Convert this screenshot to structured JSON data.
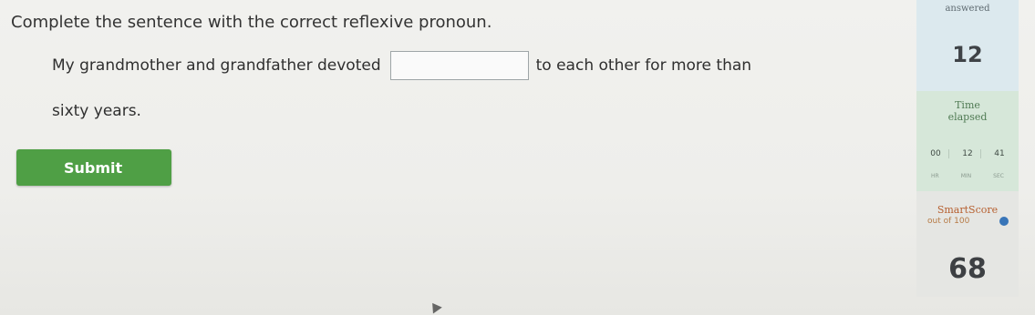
{
  "question": {
    "instructions": "Complete the sentence with the correct reflexive pronoun.",
    "sentence_before": "My grandmother and grandfather devoted",
    "sentence_after": "to each other for more than",
    "sentence_line2": "sixty years.",
    "answer_value": "",
    "submit_label": "Submit"
  },
  "sidebar": {
    "answered_label": "answered",
    "questions_answered": "12",
    "time_label_line1": "Time",
    "time_label_line2": "elapsed",
    "time": {
      "hours": "00",
      "minutes": "12",
      "seconds": "41",
      "hours_unit": "HR",
      "minutes_unit": "MIN",
      "seconds_unit": "SEC"
    },
    "smartscore_label": "SmartScore",
    "smartscore_sub": "out of 100",
    "smartscore_value": "68"
  },
  "colors": {
    "submit": "#4f9f45",
    "questions_panel": "#dce9ee",
    "time_panel": "#d6e7d9",
    "score_panel": "#e5e6e3",
    "info_icon": "#3875b8"
  }
}
